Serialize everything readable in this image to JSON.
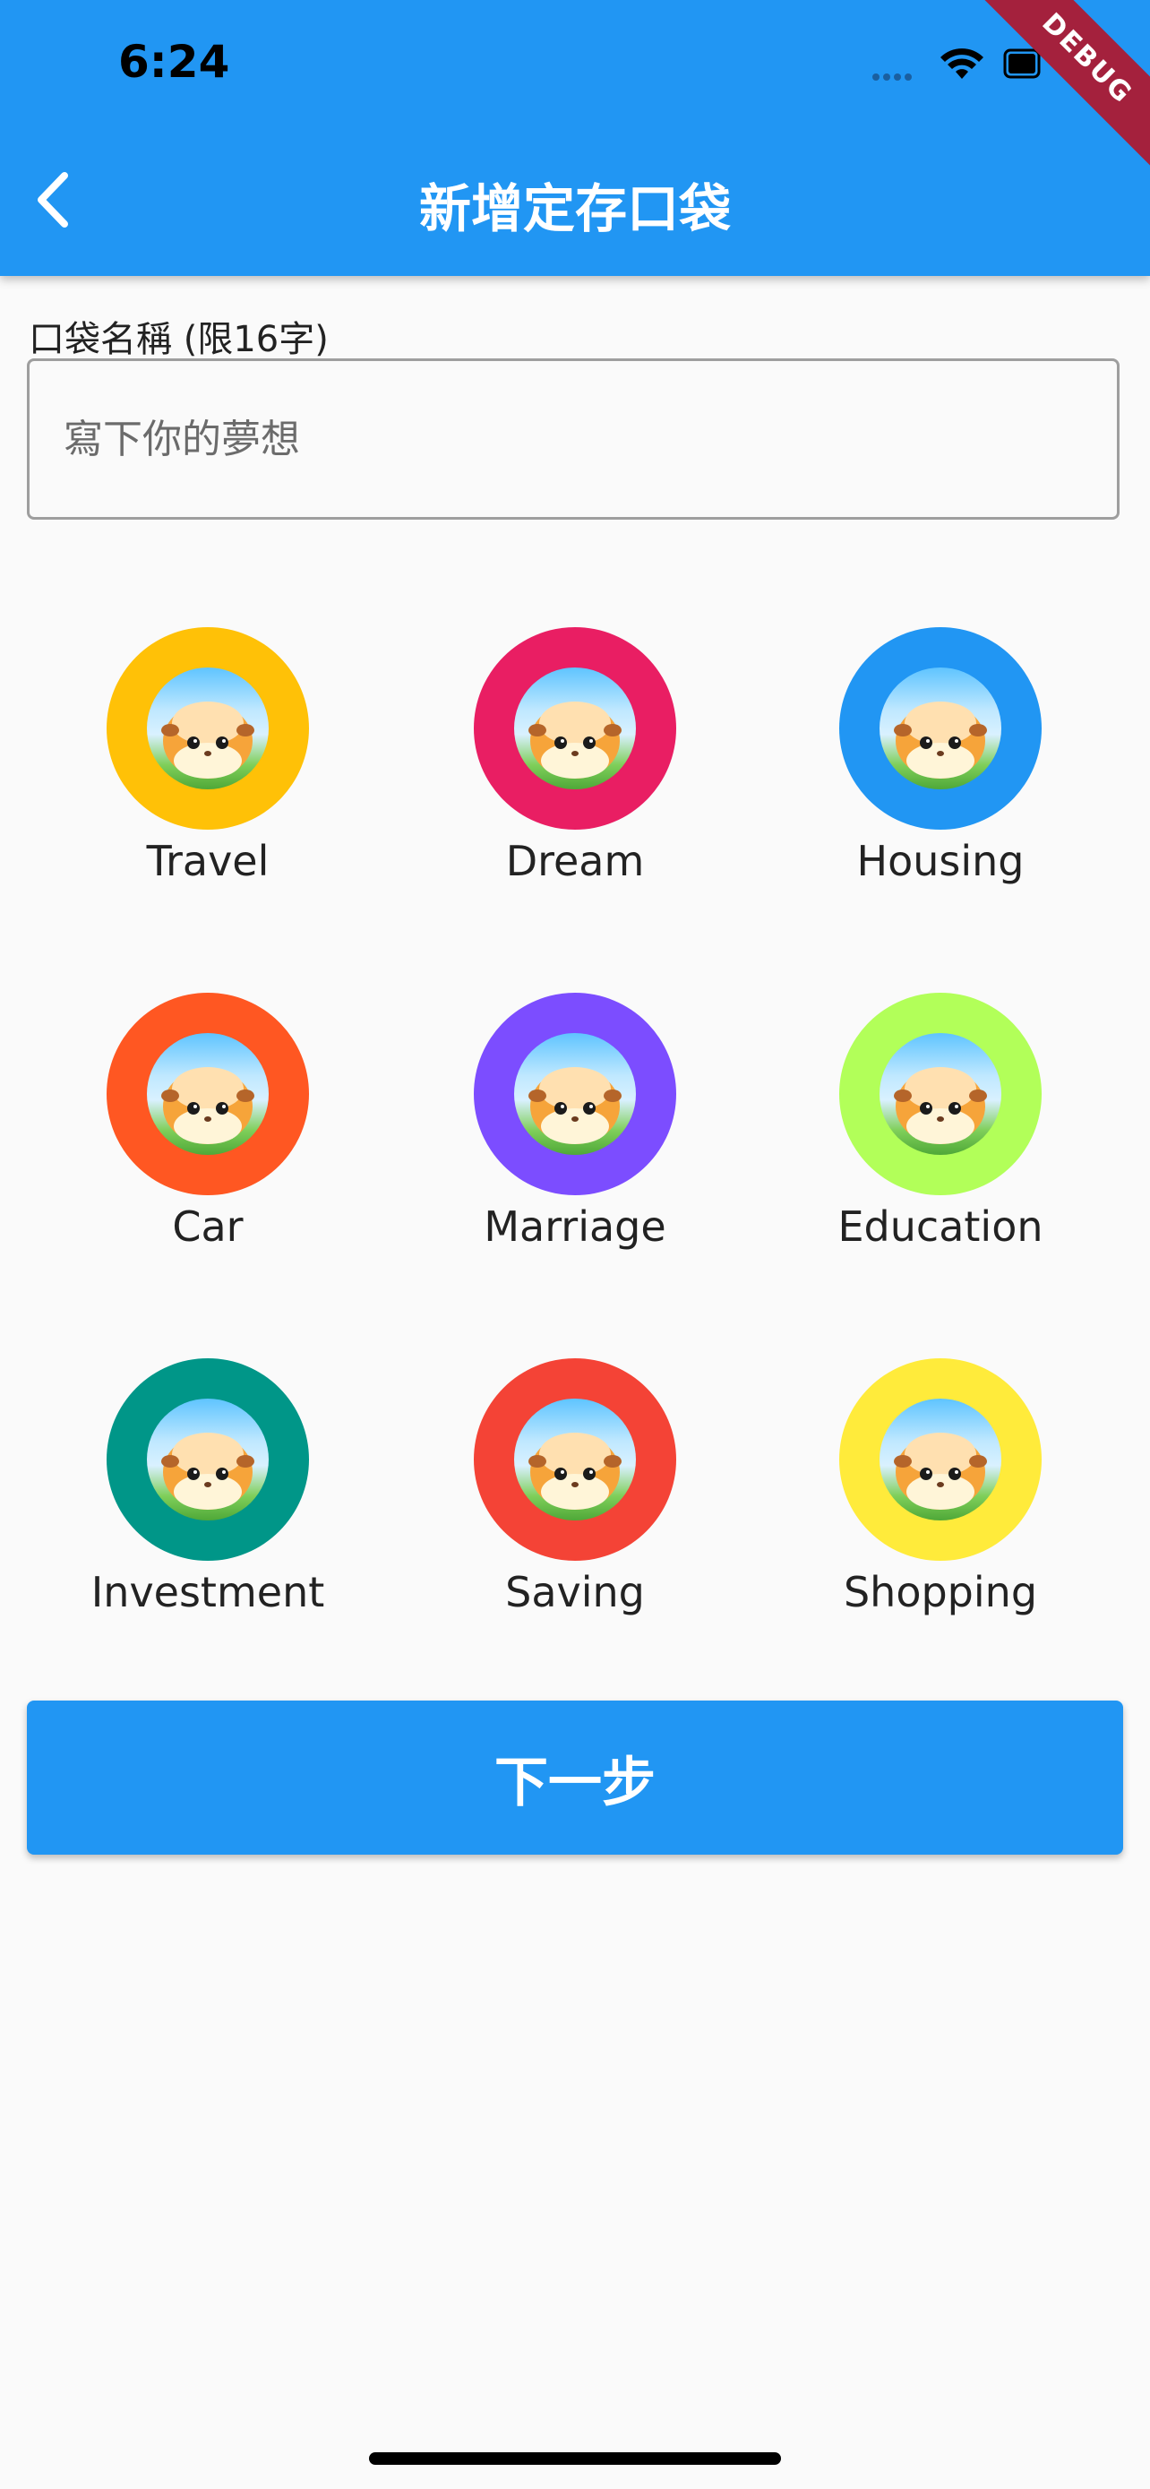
{
  "status_bar": {
    "time": "6:24"
  },
  "debug_banner": "DEBUG",
  "app_bar": {
    "title": "新增定存口袋"
  },
  "form": {
    "label": "口袋名稱 (限16字)",
    "placeholder": "寫下你的夢想",
    "value": ""
  },
  "categories": [
    {
      "label": "Travel",
      "color": "#ffc107"
    },
    {
      "label": "Dream",
      "color": "#e91e63"
    },
    {
      "label": "Housing",
      "color": "#2196f3"
    },
    {
      "label": "Car",
      "color": "#ff5722"
    },
    {
      "label": "Marriage",
      "color": "#7c4dff"
    },
    {
      "label": "Education",
      "color": "#b2ff59"
    },
    {
      "label": "Investment",
      "color": "#009688"
    },
    {
      "label": "Saving",
      "color": "#f44336"
    },
    {
      "label": "Shopping",
      "color": "#ffeb3b"
    }
  ],
  "next_button": {
    "label": "下一步"
  }
}
